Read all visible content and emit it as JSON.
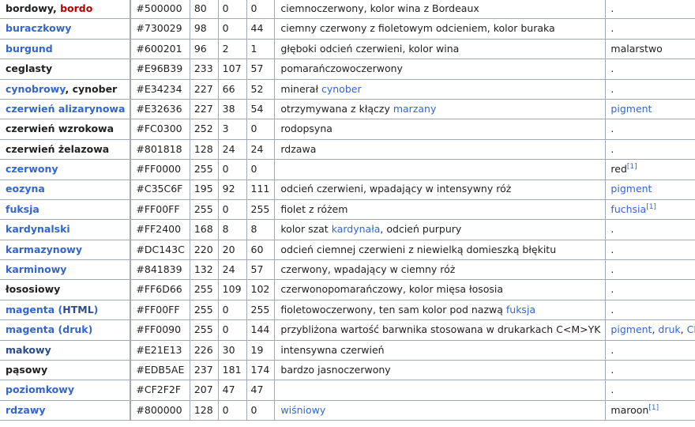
{
  "rows": [
    {
      "name": [
        {
          "t": "bordowy, ",
          "c": "black"
        },
        {
          "t": "bordo",
          "c": "red"
        }
      ],
      "hex": "#500000",
      "r": "80",
      "g": "0",
      "b": "0",
      "desc": [
        {
          "t": "ciemnoczerwony, kolor wina z Bordeaux",
          "c": "black"
        }
      ],
      "other": [
        {
          "t": ".",
          "c": "black"
        }
      ]
    },
    {
      "name": [
        {
          "t": "buraczkowy",
          "c": "link"
        }
      ],
      "hex": "#730029",
      "r": "98",
      "g": "0",
      "b": "44",
      "desc": [
        {
          "t": "ciemny czerwony z fioletowym odcieniem, kolor buraka",
          "c": "black"
        }
      ],
      "other": [
        {
          "t": ".",
          "c": "black"
        }
      ]
    },
    {
      "name": [
        {
          "t": "burgund",
          "c": "link"
        }
      ],
      "hex": "#600201",
      "r": "96",
      "g": "2",
      "b": "1",
      "desc": [
        {
          "t": "głęboki odcień czerwieni, kolor wina",
          "c": "black"
        }
      ],
      "other": [
        {
          "t": "malarstwo",
          "c": "black"
        }
      ]
    },
    {
      "name": [
        {
          "t": "ceglasty",
          "c": "black"
        }
      ],
      "hex": "#E96B39",
      "r": "233",
      "g": "107",
      "b": "57",
      "desc": [
        {
          "t": "pomarańczowoczerwony",
          "c": "black"
        }
      ],
      "other": [
        {
          "t": ".",
          "c": "black"
        }
      ]
    },
    {
      "name": [
        {
          "t": "cynobrowy",
          "c": "link"
        },
        {
          "t": ", cynober",
          "c": "black"
        }
      ],
      "hex": "#E34234",
      "r": "227",
      "g": "66",
      "b": "52",
      "desc": [
        {
          "t": "minerał ",
          "c": "black"
        },
        {
          "t": "cynober",
          "c": "link"
        }
      ],
      "other": [
        {
          "t": ".",
          "c": "black"
        }
      ]
    },
    {
      "name": [
        {
          "t": "czerwień alizarynowa",
          "c": "link"
        }
      ],
      "hex": "#E32636",
      "r": "227",
      "g": "38",
      "b": "54",
      "desc": [
        {
          "t": "otrzymywana z kłączy ",
          "c": "black"
        },
        {
          "t": "marzany",
          "c": "link"
        }
      ],
      "other": [
        {
          "t": "pigment",
          "c": "link"
        }
      ]
    },
    {
      "name": [
        {
          "t": "czerwień wzrokowa",
          "c": "black"
        }
      ],
      "hex": "#FC0300",
      "r": "252",
      "g": "3",
      "b": "0",
      "desc": [
        {
          "t": "rodopsyna",
          "c": "black"
        }
      ],
      "other": [
        {
          "t": ".",
          "c": "black"
        }
      ]
    },
    {
      "name": [
        {
          "t": "czerwień żelazowa",
          "c": "black"
        }
      ],
      "hex": "#801818",
      "r": "128",
      "g": "24",
      "b": "24",
      "desc": [
        {
          "t": "rdzawa",
          "c": "black"
        }
      ],
      "other": [
        {
          "t": ".",
          "c": "black"
        }
      ]
    },
    {
      "name": [
        {
          "t": "czerwony",
          "c": "link"
        }
      ],
      "hex": "#FF0000",
      "r": "255",
      "g": "0",
      "b": "0",
      "desc": [],
      "other": [
        {
          "t": "red",
          "c": "black"
        },
        {
          "t": "[1]",
          "c": "sup"
        }
      ]
    },
    {
      "name": [
        {
          "t": "eozyna",
          "c": "link"
        }
      ],
      "hex": "#C35C6F",
      "r": "195",
      "g": "92",
      "b": "111",
      "desc": [
        {
          "t": "odcień czerwieni, wpadający w intensywny róż",
          "c": "black"
        }
      ],
      "other": [
        {
          "t": "pigment",
          "c": "link"
        }
      ]
    },
    {
      "name": [
        {
          "t": "fuksja",
          "c": "link"
        }
      ],
      "hex": "#FF00FF",
      "r": "255",
      "g": "0",
      "b": "255",
      "desc": [
        {
          "t": "fiolet z różem",
          "c": "black"
        }
      ],
      "other": [
        {
          "t": "fuchsia",
          "c": "link"
        },
        {
          "t": "[1]",
          "c": "sup"
        }
      ]
    },
    {
      "name": [
        {
          "t": "kardynalski",
          "c": "link"
        }
      ],
      "hex": "#FF2400",
      "r": "168",
      "g": "8",
      "b": "8",
      "desc": [
        {
          "t": "kolor szat ",
          "c": "black"
        },
        {
          "t": "kardynała",
          "c": "link"
        },
        {
          "t": ", odcień purpury",
          "c": "black"
        }
      ],
      "other": [
        {
          "t": ".",
          "c": "black"
        }
      ]
    },
    {
      "name": [
        {
          "t": "karmazynowy",
          "c": "link"
        }
      ],
      "hex": "#DC143C",
      "r": "220",
      "g": "20",
      "b": "60",
      "desc": [
        {
          "t": "odcień ciemnej czerwieni z niewielką domieszką błękitu",
          "c": "black"
        }
      ],
      "other": [
        {
          "t": ".",
          "c": "black"
        }
      ]
    },
    {
      "name": [
        {
          "t": "karminowy",
          "c": "link"
        }
      ],
      "hex": "#841839",
      "r": "132",
      "g": "24",
      "b": "57",
      "desc": [
        {
          "t": "czerwony, wpadający w ciemny róż",
          "c": "black"
        }
      ],
      "other": [
        {
          "t": ".",
          "c": "black"
        }
      ]
    },
    {
      "name": [
        {
          "t": "łososiowy",
          "c": "black"
        }
      ],
      "hex": "#FF6D66",
      "r": "255",
      "g": "109",
      "b": "102",
      "desc": [
        {
          "t": "czerwonopomarańczowy, kolor mięsa łososia",
          "c": "black"
        }
      ],
      "other": [
        {
          "t": ".",
          "c": "black"
        }
      ]
    },
    {
      "name": [
        {
          "t": "magenta (",
          "c": "link"
        },
        {
          "t": "HTML",
          "c": "dark"
        },
        {
          "t": ")",
          "c": "link"
        }
      ],
      "hex": "#FF00FF",
      "r": "255",
      "g": "0",
      "b": "255",
      "desc": [
        {
          "t": "fioletowoczerwony, ten sam kolor pod nazwą ",
          "c": "black"
        },
        {
          "t": "fuksja",
          "c": "link"
        }
      ],
      "other": [
        {
          "t": ".",
          "c": "black"
        }
      ]
    },
    {
      "name": [
        {
          "t": "magenta (druk)",
          "c": "link"
        }
      ],
      "hex": "#FF0090",
      "r": "255",
      "g": "0",
      "b": "144",
      "desc": [
        {
          "t": "przybliżona wartość barwnika stosowana w drukarkach C<M>YK",
          "c": "black"
        }
      ],
      "other": [
        {
          "t": "pigment",
          "c": "link"
        },
        {
          "t": ", ",
          "c": "black"
        },
        {
          "t": "druk",
          "c": "link"
        },
        {
          "t": ", ",
          "c": "black"
        },
        {
          "t": "CMYK",
          "c": "link"
        }
      ]
    },
    {
      "name": [
        {
          "t": "makowy",
          "c": "dark"
        }
      ],
      "hex": "#E21E13",
      "r": "226",
      "g": "30",
      "b": "19",
      "desc": [
        {
          "t": "intensywna czerwień",
          "c": "black"
        }
      ],
      "other": [
        {
          "t": ".",
          "c": "black"
        }
      ]
    },
    {
      "name": [
        {
          "t": "pąsowy",
          "c": "black"
        }
      ],
      "hex": "#EDB5AE",
      "r": "237",
      "g": "181",
      "b": "174",
      "desc": [
        {
          "t": "bardzo jasnoczerwony",
          "c": "black"
        }
      ],
      "other": [
        {
          "t": ".",
          "c": "black"
        }
      ]
    },
    {
      "name": [
        {
          "t": "poziomkowy",
          "c": "link"
        }
      ],
      "hex": "#CF2F2F",
      "r": "207",
      "g": "47",
      "b": "47",
      "desc": [],
      "other": [
        {
          "t": ".",
          "c": "black"
        }
      ]
    },
    {
      "name": [
        {
          "t": "rdzawy",
          "c": "link"
        }
      ],
      "hex": "#800000",
      "r": "128",
      "g": "0",
      "b": "0",
      "desc": [
        {
          "t": "wiśniowy",
          "c": "link"
        }
      ],
      "other": [
        {
          "t": "maroon",
          "c": "black"
        },
        {
          "t": "[1]",
          "c": "sup"
        }
      ]
    }
  ],
  "swatch_colors": [
    "#500000",
    "#730029",
    "#600201",
    "#E96B39",
    "#E34234",
    "#E32636",
    "#FC0300",
    "#801818",
    "#FF0000",
    "#C35C6F",
    "#FF00FF",
    "#FF2400",
    "#DC143C",
    "#841839",
    "#FF6D66",
    "#FF00FF",
    "#FF0090",
    "#E21E13",
    "#EDB5AE",
    "#CF2F2F",
    "#800000"
  ]
}
